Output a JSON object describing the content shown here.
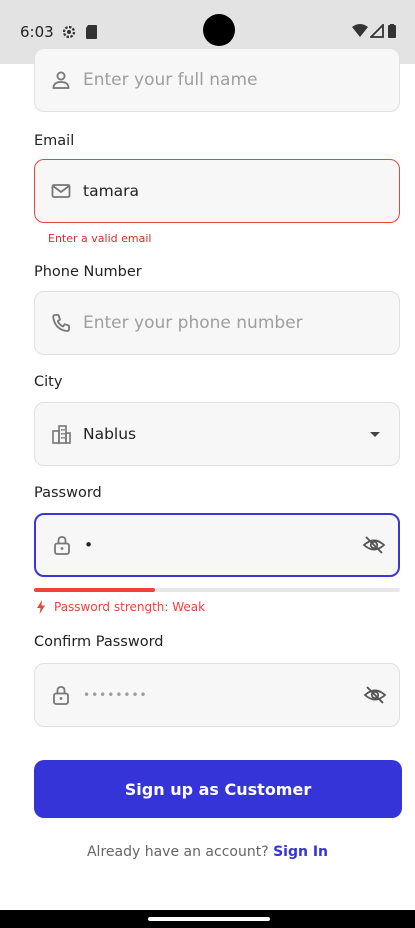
{
  "status_bar": {
    "time": "6:03"
  },
  "form": {
    "full_name": {
      "placeholder": "Enter your full name",
      "icon": "person-icon"
    },
    "email": {
      "label": "Email",
      "value": "tamara",
      "error": "Enter a valid email",
      "icon": "mail-icon"
    },
    "phone": {
      "label": "Phone Number",
      "placeholder": "Enter your phone number",
      "icon": "phone-icon"
    },
    "city": {
      "label": "City",
      "value": "Nablus",
      "icon": "city-icon"
    },
    "password": {
      "label": "Password",
      "value": "•",
      "strength_text": "Password strength: Weak",
      "strength_fraction": 0.33
    },
    "confirm_password": {
      "label": "Confirm Password",
      "placeholder": "••••••••"
    },
    "submit_label": "Sign up as Customer",
    "footer_text": "Already have an account?",
    "signin_label": "Sign In"
  },
  "colors": {
    "primary": "#3434d9",
    "error": "#e8453c",
    "field_bg": "#f7f7f7"
  }
}
